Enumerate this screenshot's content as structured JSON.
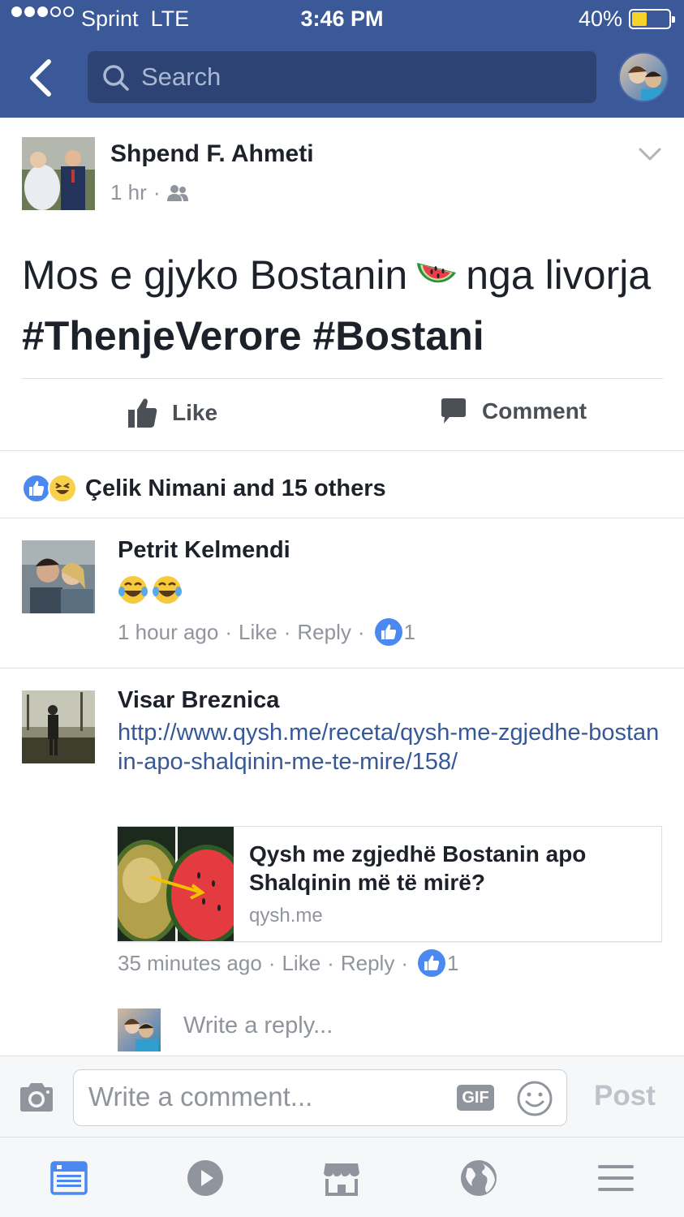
{
  "status_bar": {
    "carrier": "Sprint",
    "network": "LTE",
    "time": "3:46 PM",
    "battery": "40%",
    "battery_level": 0.4
  },
  "search": {
    "placeholder": "Search"
  },
  "post": {
    "author": "Shpend F. Ahmeti",
    "time": "1 hr",
    "audience_icon": "friends-icon",
    "text_before_emoji": "Mos e gjyko Bostanin",
    "emoji": "watermelon",
    "text_after_emoji": "nga livorja",
    "hashtags": "#ThenjeVerore #Bostani"
  },
  "actions": {
    "like": "Like",
    "comment": "Comment"
  },
  "reactions": {
    "summary": "Çelik Nimani and 15 others"
  },
  "comments": [
    {
      "name": "Petrit Kelmendi",
      "content_emoji": "face-with-tears-of-joy x2",
      "time": "1 hour ago",
      "like": "Like",
      "reply": "Reply",
      "like_count": "1"
    },
    {
      "name": "Visar Breznica",
      "link": "http://www.qysh.me/receta/qysh-me-zgjedhe-bostanin-apo-shalqinin-me-te-mire/158/",
      "card_title": "Qysh me zgjedhë Bostanin apo Shalqinin më të mirë?",
      "card_domain": "qysh.me",
      "time": "35 minutes ago",
      "like": "Like",
      "reply": "Reply",
      "like_count": "1"
    }
  ],
  "reply": {
    "placeholder": "Write a reply..."
  },
  "composer": {
    "placeholder": "Write a comment...",
    "gif": "GIF",
    "post": "Post"
  },
  "tabs": [
    "news-feed-icon",
    "video-icon",
    "marketplace-icon",
    "notifications-globe-icon",
    "menu-icon"
  ],
  "colors": {
    "brand": "#3b5998",
    "link": "#365899",
    "like": "#4b89f0",
    "muted": "#90949c"
  }
}
